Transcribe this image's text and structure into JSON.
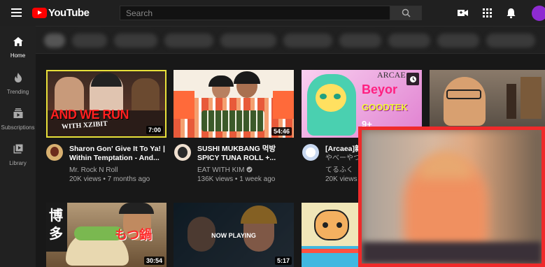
{
  "header": {
    "logo_text": "YouTube",
    "search_placeholder": "Search"
  },
  "sidebar": {
    "items": [
      {
        "label": "Home"
      },
      {
        "label": "Trending"
      },
      {
        "label": "Subscriptions"
      },
      {
        "label": "Library"
      }
    ]
  },
  "videos": [
    {
      "title_line1": "Sharon Gon' Give It To Ya! |",
      "title_line2": "Within Temptation - And...",
      "channel": "Mr. Rock N Roll",
      "meta": "20K views • 7 months ago",
      "duration": "7:00",
      "thumb_text_1": "AND WE RUN",
      "thumb_text_2": "WITH XZIBIT"
    },
    {
      "title_line1": "SUSHI MUKBANG 먹방",
      "title_line2": "SPICY TUNA ROLL +...",
      "channel": "EAT WITH KIM",
      "meta": "136K views • 1 week ago",
      "duration": "54:46"
    },
    {
      "title_line1": "[Arcaea]新",
      "title_line2": "",
      "channel": "やべーやつ",
      "channel2": "てるふく",
      "meta": "20K views",
      "thumb_text_1": "Beyor",
      "thumb_text_2": "GOODTEK",
      "thumb_text_3": "ARCAE",
      "thumb_text_4": "9+"
    },
    {
      "duration": "30:54",
      "thumb_text_1": "博",
      "thumb_text_2": "多",
      "thumb_text_3": "もつ鍋"
    },
    {
      "duration": "5:17",
      "overlay": "NOW PLAYING"
    },
    {}
  ],
  "colors": {
    "brand_red": "#ff0000",
    "pip_border": "#ef2a2a",
    "avatar": "#8e2bd1"
  },
  "icons": [
    "menu-icon",
    "youtube-logo-icon",
    "search-icon",
    "video-camera-icon",
    "apps-grid-icon",
    "bell-icon",
    "home-icon",
    "trending-icon",
    "subscriptions-icon",
    "library-icon",
    "verified-icon",
    "watch-later-icon"
  ]
}
